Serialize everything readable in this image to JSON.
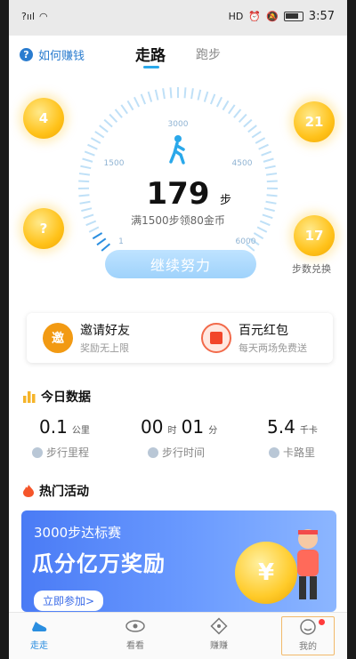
{
  "status_bar": {
    "signal_text": "?ııl",
    "net_label": "HD",
    "time": "3:57"
  },
  "header": {
    "help_label": "如何赚钱",
    "tabs": [
      {
        "label": "走路",
        "active": true
      },
      {
        "label": "跑步",
        "active": false
      }
    ]
  },
  "gauge": {
    "steps": "179",
    "steps_unit": "步",
    "hint": "满1500步领80金币",
    "tick_labels": [
      "1",
      "1500",
      "3000",
      "4500",
      "6000"
    ]
  },
  "coins": [
    {
      "value": "4"
    },
    {
      "value": "21"
    },
    {
      "value": "?"
    },
    {
      "value": "17"
    }
  ],
  "exchange_label": "步数兑换",
  "cta_label": "继续努力",
  "promo": {
    "invite_icon": "邀",
    "invite_title": "邀请好友",
    "invite_sub": "奖励无上限",
    "red_title": "百元红包",
    "red_sub": "每天两场免费送"
  },
  "today": {
    "title": "今日数据",
    "distance_value": "0.1",
    "distance_unit": "公里",
    "distance_label": "步行里程",
    "time_hours": "00",
    "time_hours_unit": "时",
    "time_minutes": "01",
    "time_minutes_unit": "分",
    "time_label": "步行时间",
    "calorie_value": "5.4",
    "calorie_unit": "千卡",
    "calorie_label": "卡路里"
  },
  "events": {
    "title": "热门活动",
    "banner_line1": "3000步达标赛",
    "banner_line2": "瓜分亿万奖励",
    "banner_button": "立即参加>",
    "banner_coin_symbol": "¥"
  },
  "tabbar": {
    "items": [
      {
        "label": "走走",
        "active": true
      },
      {
        "label": "看看",
        "active": false
      },
      {
        "label": "赚赚",
        "active": false
      },
      {
        "label": "我的",
        "active": false
      }
    ]
  },
  "colors": {
    "accent": "#2aa8ea",
    "coin": "#ffc21a",
    "banner": "#4a7bf5"
  }
}
